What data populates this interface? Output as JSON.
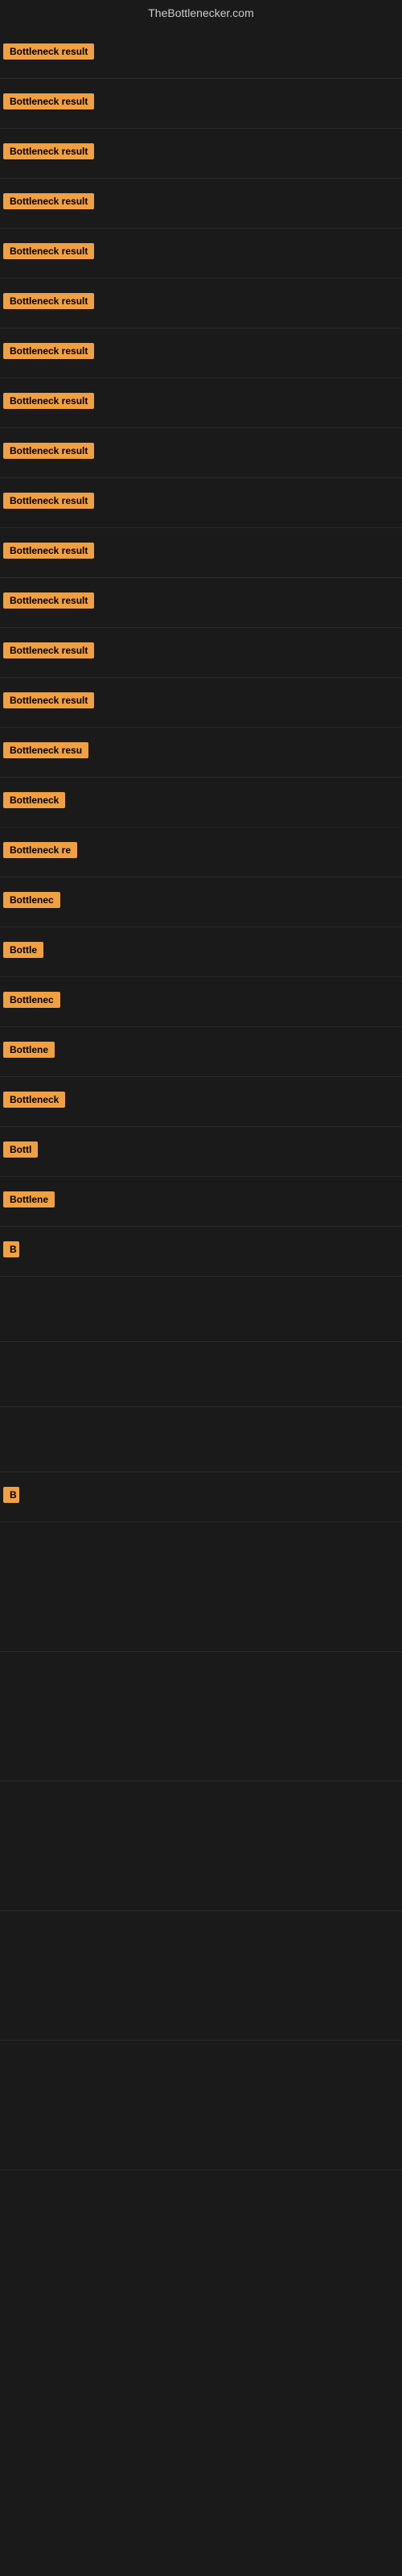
{
  "header": {
    "title": "TheBottlenecker.com"
  },
  "badge_label": "Bottleneck result",
  "rows": [
    {
      "id": 1,
      "width_class": "badge-full",
      "label": "Bottleneck result"
    },
    {
      "id": 2,
      "width_class": "badge-full",
      "label": "Bottleneck result"
    },
    {
      "id": 3,
      "width_class": "badge-full",
      "label": "Bottleneck result"
    },
    {
      "id": 4,
      "width_class": "badge-full",
      "label": "Bottleneck result"
    },
    {
      "id": 5,
      "width_class": "badge-full",
      "label": "Bottleneck result"
    },
    {
      "id": 6,
      "width_class": "badge-full",
      "label": "Bottleneck result"
    },
    {
      "id": 7,
      "width_class": "badge-full",
      "label": "Bottleneck result"
    },
    {
      "id": 8,
      "width_class": "badge-full",
      "label": "Bottleneck result"
    },
    {
      "id": 9,
      "width_class": "badge-full",
      "label": "Bottleneck result"
    },
    {
      "id": 10,
      "width_class": "badge-full",
      "label": "Bottleneck result"
    },
    {
      "id": 11,
      "width_class": "badge-full",
      "label": "Bottleneck result"
    },
    {
      "id": 12,
      "width_class": "badge-full",
      "label": "Bottleneck result"
    },
    {
      "id": 13,
      "width_class": "badge-full",
      "label": "Bottleneck result"
    },
    {
      "id": 14,
      "width_class": "badge-full",
      "label": "Bottleneck result"
    },
    {
      "id": 15,
      "width_class": "badge-w140",
      "label": "Bottleneck resu"
    },
    {
      "id": 16,
      "width_class": "badge-w100",
      "label": "Bottleneck"
    },
    {
      "id": 17,
      "width_class": "badge-w120",
      "label": "Bottleneck re"
    },
    {
      "id": 18,
      "width_class": "badge-w90",
      "label": "Bottlenec"
    },
    {
      "id": 19,
      "width_class": "badge-w70",
      "label": "Bottle"
    },
    {
      "id": 20,
      "width_class": "badge-w90",
      "label": "Bottlenec"
    },
    {
      "id": 21,
      "width_class": "badge-w80",
      "label": "Bottlene"
    },
    {
      "id": 22,
      "width_class": "badge-w95",
      "label": "Bottleneck"
    },
    {
      "id": 23,
      "width_class": "badge-w65",
      "label": "Bottl"
    },
    {
      "id": 24,
      "width_class": "badge-w90",
      "label": "Bottlene"
    },
    {
      "id": 25,
      "width_class": "badge-w20",
      "label": "B"
    }
  ],
  "empty_rows": [
    {
      "id": 26
    },
    {
      "id": 27
    },
    {
      "id": 28
    }
  ],
  "final_rows": [
    {
      "id": 29,
      "width_class": "badge-w20",
      "label": "B"
    },
    {
      "id": 30,
      "empty": true
    },
    {
      "id": 31,
      "empty": true
    },
    {
      "id": 32,
      "empty": true
    },
    {
      "id": 33,
      "empty": true
    },
    {
      "id": 34,
      "empty": true
    },
    {
      "id": 35,
      "empty": true
    }
  ]
}
